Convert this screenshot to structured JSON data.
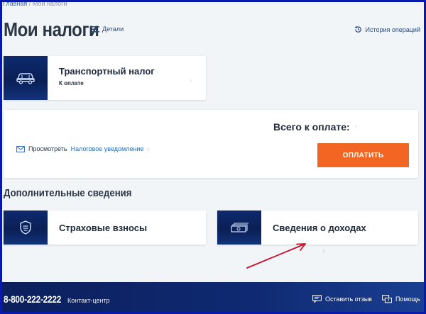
{
  "breadcrumb": {
    "home": "Главная",
    "separator": "/",
    "current": "Мои налоги"
  },
  "header": {
    "title": "Мои налоги",
    "details_label": "Детали",
    "history_label": "История операций"
  },
  "transport_card": {
    "title": "Транспортный налог",
    "subtitle": "К оплате",
    "chevron": "›"
  },
  "payment": {
    "notice_prefix": "Просмотреть",
    "notice_link": "Налоговое уведомление",
    "notice_suffix": "›",
    "total_label": "Всего к оплате:",
    "total_value": "›",
    "pay_button": "ОПЛАТИТЬ"
  },
  "additional": {
    "section_title": "Дополнительные сведения",
    "insurance_title": "Страховые взносы",
    "income_title": "Сведения о доходах"
  },
  "footer": {
    "phone": "8-800-222-2222",
    "contact_label": "Контакт-центр",
    "feedback_label": "Оставить отзыв",
    "help_label": "Помощь"
  },
  "colors": {
    "accent": "#f26522",
    "brand_navy": "#0c1f5c",
    "link": "#2a6bb8",
    "frame": "#0a1aa8",
    "annotation_arrow": "#c8102e"
  },
  "icons": [
    "details-list-icon",
    "history-clock-icon",
    "car-icon",
    "envelope-icon",
    "shield-icon",
    "money-stack-icon",
    "feedback-icon",
    "help-icon",
    "annotation-arrow"
  ]
}
